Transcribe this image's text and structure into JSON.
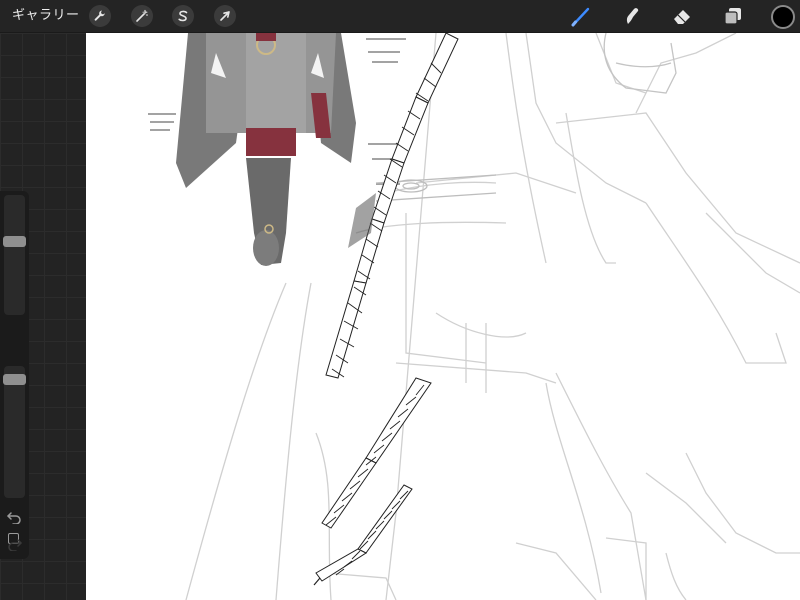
{
  "topbar": {
    "gallery_label": "ギャラリー",
    "left_tools": [
      {
        "name": "actions",
        "icon": "wrench-icon"
      },
      {
        "name": "adjustments",
        "icon": "magic-wand-icon"
      },
      {
        "name": "selection",
        "icon": "selection-s-icon"
      },
      {
        "name": "transform",
        "icon": "arrow-cursor-icon"
      }
    ],
    "right_tools": [
      {
        "name": "brush",
        "icon": "brush-icon",
        "active": true
      },
      {
        "name": "smudge",
        "icon": "smudge-icon",
        "active": false
      },
      {
        "name": "eraser",
        "icon": "eraser-icon",
        "active": false
      },
      {
        "name": "layers",
        "icon": "layers-icon",
        "active": false
      }
    ],
    "current_color": "#000000",
    "accent_color": "#3d8bff"
  },
  "sidebar": {
    "brush_size_level": 0.62,
    "opacity_level": 0.97,
    "modifier_icon": "square-modifier-icon",
    "undo_icon": "undo-icon",
    "redo_icon": "redo-icon"
  },
  "canvas": {
    "background": "#ffffff",
    "reference_palette": [
      "#6e6e6e",
      "#7a1c2a",
      "#c8b27a",
      "#bdbdbd"
    ]
  }
}
